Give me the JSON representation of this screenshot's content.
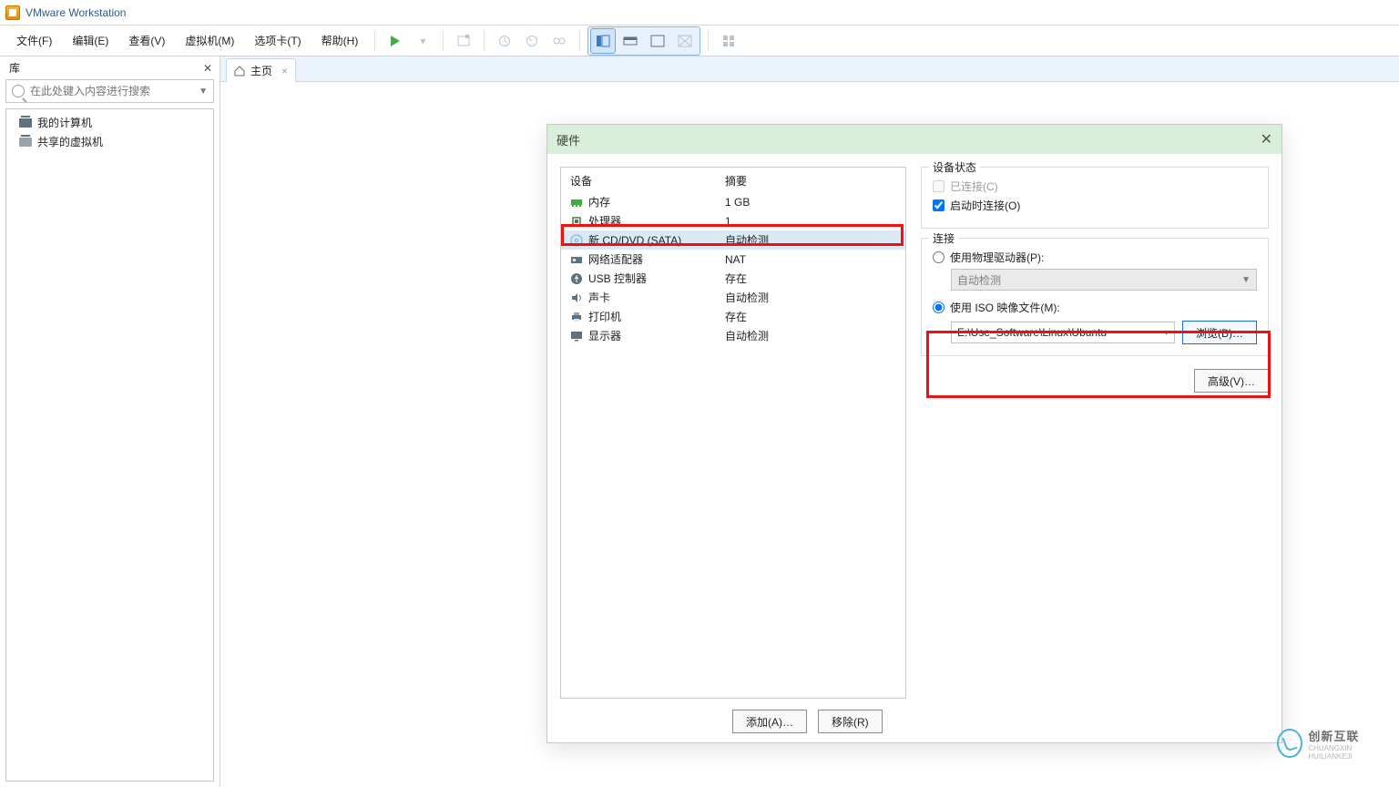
{
  "window": {
    "title": "VMware Workstation"
  },
  "menu": {
    "file": "文件(F)",
    "edit": "编辑(E)",
    "view": "查看(V)",
    "vm": "虚拟机(M)",
    "tabs": "选项卡(T)",
    "help": "帮助(H)"
  },
  "sidebar": {
    "title": "库",
    "search_placeholder": "在此处键入内容进行搜索",
    "tree": {
      "my_computer": "我的计算机",
      "shared_vms": "共享的虚拟机"
    }
  },
  "tab": {
    "home": "主页"
  },
  "dialog": {
    "title": "硬件",
    "device_header": "设备",
    "summary_header": "摘要",
    "devices": [
      {
        "name": "内存",
        "summary": "1 GB",
        "icon": "memory-icon"
      },
      {
        "name": "处理器",
        "summary": "1",
        "icon": "cpu-icon"
      },
      {
        "name": "新 CD/DVD (SATA)",
        "summary": "自动检测",
        "icon": "disc-icon",
        "selected": true
      },
      {
        "name": "网络适配器",
        "summary": "NAT",
        "icon": "nic-icon"
      },
      {
        "name": "USB 控制器",
        "summary": "存在",
        "icon": "usb-icon"
      },
      {
        "name": "声卡",
        "summary": "自动检测",
        "icon": "sound-icon"
      },
      {
        "name": "打印机",
        "summary": "存在",
        "icon": "printer-icon"
      },
      {
        "name": "显示器",
        "summary": "自动检测",
        "icon": "display-icon"
      }
    ],
    "state_legend": "设备状态",
    "connected_label": "已连接(C)",
    "connect_on_label": "启动时连接(O)",
    "conn_legend": "连接",
    "use_phys_label": "使用物理驱动器(P):",
    "phys_combo_value": "自动检测",
    "use_iso_label": "使用 ISO 映像文件(M):",
    "iso_path": "E:\\Use_Software\\Linux\\Ubuntu",
    "browse_label": "浏览(B)…",
    "advanced_label": "高级(V)…",
    "add_label": "添加(A)…",
    "remove_label": "移除(R)"
  },
  "watermark": {
    "brand": "创新互联",
    "sub": "CHUANGXIN HUILIANKEJI"
  }
}
